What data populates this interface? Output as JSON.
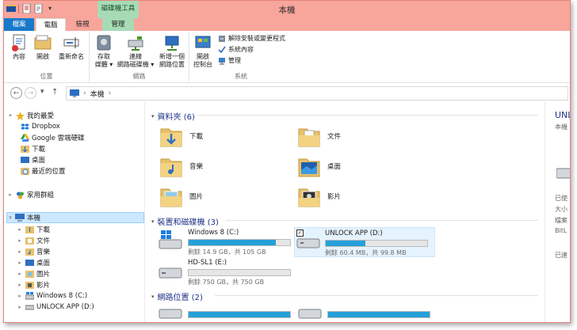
{
  "window": {
    "title": "本機"
  },
  "quick_access": {
    "icons": [
      "save-icon",
      "properties-icon",
      "new-folder-icon",
      "dropdown-icon"
    ]
  },
  "ribbon_tabs": {
    "file": "檔案",
    "computer": "電腦",
    "view": "檢視",
    "manage": "管理",
    "context_label": "磁碟機工具"
  },
  "ribbon": {
    "location_group": {
      "label": "位置",
      "properties": "內容",
      "open": "開啟",
      "rename": "重新命名"
    },
    "network_group": {
      "label": "網路",
      "access_media": "存取\n媒體 ▾",
      "map_drive": "連線\n網路磁碟機 ▾",
      "add_location": "新增一個\n網路位置"
    },
    "system_group": {
      "label": "系統",
      "open_control_panel": "開啟\n控制台",
      "uninstall": "解除安裝或變更程式",
      "system_properties": "系統內容",
      "manage": "管理"
    }
  },
  "address": {
    "path_root": "本機",
    "sep": "›"
  },
  "nav_pane": {
    "favorites": "我的最愛",
    "fav_items": [
      "Dropbox",
      "Google 雲端硬碟",
      "下載",
      "桌面",
      "最近的位置"
    ],
    "homegroup": "家用群組",
    "this_pc": "本機",
    "pc_items": [
      "下載",
      "文件",
      "音樂",
      "桌面",
      "圖片",
      "影片",
      "Windows 8 (C:)",
      "UNLOCK APP (D:)"
    ]
  },
  "folders_section": {
    "title": "資料夾 (6)",
    "items": [
      "下載",
      "文件",
      "音樂",
      "桌面",
      "圖片",
      "影片"
    ]
  },
  "drives_section": {
    "title": "裝置和磁碟機 (3)",
    "drives": [
      {
        "name": "Windows 8 (C:)",
        "free": "剩餘 14.9 GB，共 105 GB",
        "used_fraction": 0.86
      },
      {
        "name": "UNLOCK APP (D:)",
        "free": "剩餘 60.4 MB，共 99.8 MB",
        "used_fraction": 0.39
      },
      {
        "name": "HD-SL1 (E:)",
        "free": "剩餘 750 GB，共 750 GB",
        "used_fraction": 0.0
      }
    ]
  },
  "network_section": {
    "title": "網路位置 (2)"
  },
  "details_pane": {
    "lines": [
      "UNL",
      "本機",
      "已使",
      "大小",
      "檔案",
      "BitL",
      "已連"
    ]
  }
}
